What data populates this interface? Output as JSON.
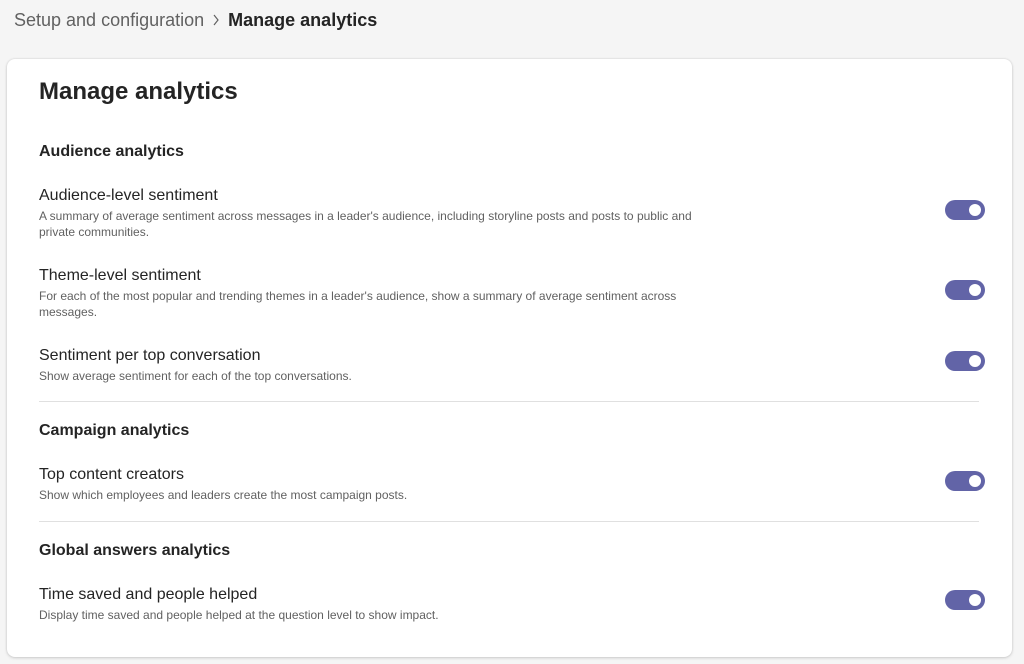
{
  "breadcrumb": {
    "parent": "Setup and configuration",
    "current": "Manage analytics"
  },
  "page": {
    "title": "Manage analytics"
  },
  "sections": {
    "audience": {
      "heading": "Audience analytics",
      "items": [
        {
          "title": "Audience-level sentiment",
          "description": "A summary of average sentiment across messages in a leader's audience, including storyline posts and posts to public and private communities.",
          "enabled": true
        },
        {
          "title": "Theme-level sentiment",
          "description": "For each of the most popular and trending themes in a leader's audience, show a summary of average sentiment across messages.",
          "enabled": true
        },
        {
          "title": "Sentiment per top conversation",
          "description": "Show average sentiment for each of the top conversations.",
          "enabled": true
        }
      ]
    },
    "campaign": {
      "heading": "Campaign analytics",
      "items": [
        {
          "title": "Top content creators",
          "description": "Show which employees and leaders create the most campaign posts.",
          "enabled": true
        }
      ]
    },
    "global_answers": {
      "heading": "Global answers analytics",
      "items": [
        {
          "title": "Time saved and people helped",
          "description": "Display time saved and people helped at the question level to show impact.",
          "enabled": true
        }
      ]
    }
  },
  "colors": {
    "toggle_on": "#6264a7",
    "page_background": "#f5f5f5",
    "card_background": "#ffffff"
  },
  "icons": {
    "breadcrumb_separator": "chevron-right-icon"
  }
}
